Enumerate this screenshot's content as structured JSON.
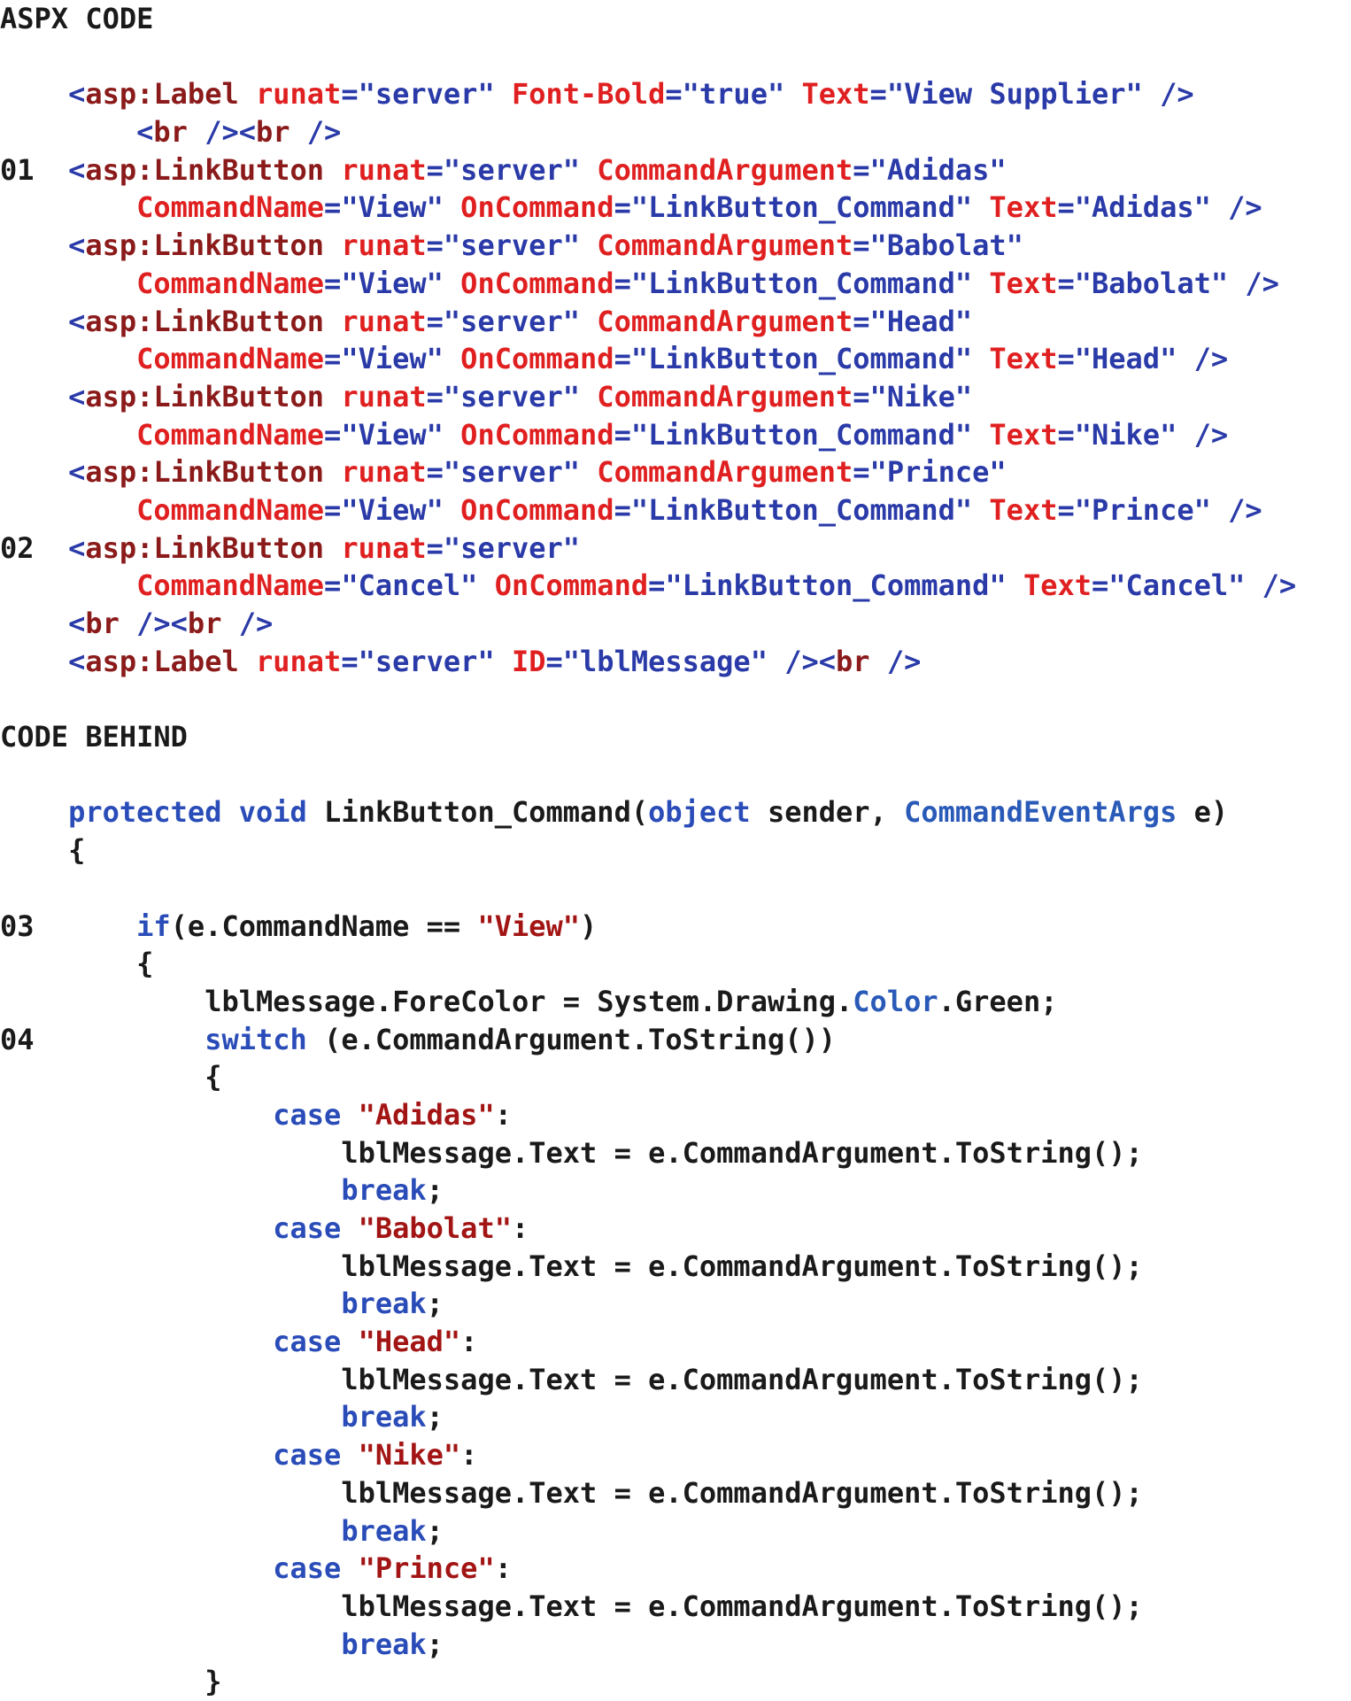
{
  "colors": {
    "default": "#1a1a1a",
    "tag": "#8b1a1a",
    "attribute": "#e02020",
    "attribute_value": "#2a3aa8",
    "delimiter": "#2a3aa8",
    "keyword": "#2a4cb8",
    "type": "#2a5ab8",
    "string": "#a31515"
  },
  "lines": [
    [
      [
        "heading",
        "ASPX CODE"
      ]
    ],
    [],
    [
      [
        "default",
        "    "
      ],
      [
        "delim",
        "<"
      ],
      [
        "tag",
        "asp:Label"
      ],
      [
        "default",
        " "
      ],
      [
        "attr",
        "runat"
      ],
      [
        "delim",
        "="
      ],
      [
        "value",
        "\"server\""
      ],
      [
        "default",
        " "
      ],
      [
        "attr",
        "Font-Bold"
      ],
      [
        "delim",
        "="
      ],
      [
        "value",
        "\"true\""
      ],
      [
        "default",
        " "
      ],
      [
        "attr",
        "Text"
      ],
      [
        "delim",
        "="
      ],
      [
        "value",
        "\"View Supplier\""
      ],
      [
        "default",
        " "
      ],
      [
        "delim",
        "/>"
      ]
    ],
    [
      [
        "default",
        "        "
      ],
      [
        "delim",
        "<"
      ],
      [
        "tag",
        "br"
      ],
      [
        "default",
        " "
      ],
      [
        "delim",
        "/><"
      ],
      [
        "tag",
        "br"
      ],
      [
        "default",
        " "
      ],
      [
        "delim",
        "/>"
      ]
    ],
    [
      [
        "linenum",
        "01"
      ],
      [
        "default",
        "  "
      ],
      [
        "delim",
        "<"
      ],
      [
        "tag",
        "asp:LinkButton"
      ],
      [
        "default",
        " "
      ],
      [
        "attr",
        "runat"
      ],
      [
        "delim",
        "="
      ],
      [
        "value",
        "\"server\""
      ],
      [
        "default",
        " "
      ],
      [
        "attr",
        "CommandArgument"
      ],
      [
        "delim",
        "="
      ],
      [
        "value",
        "\"Adidas\""
      ]
    ],
    [
      [
        "default",
        "        "
      ],
      [
        "attr",
        "CommandName"
      ],
      [
        "delim",
        "="
      ],
      [
        "value",
        "\"View\""
      ],
      [
        "default",
        " "
      ],
      [
        "attr",
        "OnCommand"
      ],
      [
        "delim",
        "="
      ],
      [
        "value",
        "\"LinkButton_Command\""
      ],
      [
        "default",
        " "
      ],
      [
        "attr",
        "Text"
      ],
      [
        "delim",
        "="
      ],
      [
        "value",
        "\"Adidas\""
      ],
      [
        "default",
        " "
      ],
      [
        "delim",
        "/>"
      ]
    ],
    [
      [
        "default",
        "    "
      ],
      [
        "delim",
        "<"
      ],
      [
        "tag",
        "asp:LinkButton"
      ],
      [
        "default",
        " "
      ],
      [
        "attr",
        "runat"
      ],
      [
        "delim",
        "="
      ],
      [
        "value",
        "\"server\""
      ],
      [
        "default",
        " "
      ],
      [
        "attr",
        "CommandArgument"
      ],
      [
        "delim",
        "="
      ],
      [
        "value",
        "\"Babolat\""
      ]
    ],
    [
      [
        "default",
        "        "
      ],
      [
        "attr",
        "CommandName"
      ],
      [
        "delim",
        "="
      ],
      [
        "value",
        "\"View\""
      ],
      [
        "default",
        " "
      ],
      [
        "attr",
        "OnCommand"
      ],
      [
        "delim",
        "="
      ],
      [
        "value",
        "\"LinkButton_Command\""
      ],
      [
        "default",
        " "
      ],
      [
        "attr",
        "Text"
      ],
      [
        "delim",
        "="
      ],
      [
        "value",
        "\"Babolat\""
      ],
      [
        "default",
        " "
      ],
      [
        "delim",
        "/>"
      ]
    ],
    [
      [
        "default",
        "    "
      ],
      [
        "delim",
        "<"
      ],
      [
        "tag",
        "asp:LinkButton"
      ],
      [
        "default",
        " "
      ],
      [
        "attr",
        "runat"
      ],
      [
        "delim",
        "="
      ],
      [
        "value",
        "\"server\""
      ],
      [
        "default",
        " "
      ],
      [
        "attr",
        "CommandArgument"
      ],
      [
        "delim",
        "="
      ],
      [
        "value",
        "\"Head\""
      ]
    ],
    [
      [
        "default",
        "        "
      ],
      [
        "attr",
        "CommandName"
      ],
      [
        "delim",
        "="
      ],
      [
        "value",
        "\"View\""
      ],
      [
        "default",
        " "
      ],
      [
        "attr",
        "OnCommand"
      ],
      [
        "delim",
        "="
      ],
      [
        "value",
        "\"LinkButton_Command\""
      ],
      [
        "default",
        " "
      ],
      [
        "attr",
        "Text"
      ],
      [
        "delim",
        "="
      ],
      [
        "value",
        "\"Head\""
      ],
      [
        "default",
        " "
      ],
      [
        "delim",
        "/>"
      ]
    ],
    [
      [
        "default",
        "    "
      ],
      [
        "delim",
        "<"
      ],
      [
        "tag",
        "asp:LinkButton"
      ],
      [
        "default",
        " "
      ],
      [
        "attr",
        "runat"
      ],
      [
        "delim",
        "="
      ],
      [
        "value",
        "\"server\""
      ],
      [
        "default",
        " "
      ],
      [
        "attr",
        "CommandArgument"
      ],
      [
        "delim",
        "="
      ],
      [
        "value",
        "\"Nike\""
      ]
    ],
    [
      [
        "default",
        "        "
      ],
      [
        "attr",
        "CommandName"
      ],
      [
        "delim",
        "="
      ],
      [
        "value",
        "\"View\""
      ],
      [
        "default",
        " "
      ],
      [
        "attr",
        "OnCommand"
      ],
      [
        "delim",
        "="
      ],
      [
        "value",
        "\"LinkButton_Command\""
      ],
      [
        "default",
        " "
      ],
      [
        "attr",
        "Text"
      ],
      [
        "delim",
        "="
      ],
      [
        "value",
        "\"Nike\""
      ],
      [
        "default",
        " "
      ],
      [
        "delim",
        "/>"
      ]
    ],
    [
      [
        "default",
        "    "
      ],
      [
        "delim",
        "<"
      ],
      [
        "tag",
        "asp:LinkButton"
      ],
      [
        "default",
        " "
      ],
      [
        "attr",
        "runat"
      ],
      [
        "delim",
        "="
      ],
      [
        "value",
        "\"server\""
      ],
      [
        "default",
        " "
      ],
      [
        "attr",
        "CommandArgument"
      ],
      [
        "delim",
        "="
      ],
      [
        "value",
        "\"Prince\""
      ]
    ],
    [
      [
        "default",
        "        "
      ],
      [
        "attr",
        "CommandName"
      ],
      [
        "delim",
        "="
      ],
      [
        "value",
        "\"View\""
      ],
      [
        "default",
        " "
      ],
      [
        "attr",
        "OnCommand"
      ],
      [
        "delim",
        "="
      ],
      [
        "value",
        "\"LinkButton_Command\""
      ],
      [
        "default",
        " "
      ],
      [
        "attr",
        "Text"
      ],
      [
        "delim",
        "="
      ],
      [
        "value",
        "\"Prince\""
      ],
      [
        "default",
        " "
      ],
      [
        "delim",
        "/>"
      ]
    ],
    [
      [
        "linenum",
        "02"
      ],
      [
        "default",
        "  "
      ],
      [
        "delim",
        "<"
      ],
      [
        "tag",
        "asp:LinkButton"
      ],
      [
        "default",
        " "
      ],
      [
        "attr",
        "runat"
      ],
      [
        "delim",
        "="
      ],
      [
        "value",
        "\"server\""
      ]
    ],
    [
      [
        "default",
        "        "
      ],
      [
        "attr",
        "CommandName"
      ],
      [
        "delim",
        "="
      ],
      [
        "value",
        "\"Cancel\""
      ],
      [
        "default",
        " "
      ],
      [
        "attr",
        "OnCommand"
      ],
      [
        "delim",
        "="
      ],
      [
        "value",
        "\"LinkButton_Command\""
      ],
      [
        "default",
        " "
      ],
      [
        "attr",
        "Text"
      ],
      [
        "delim",
        "="
      ],
      [
        "value",
        "\"Cancel\""
      ],
      [
        "default",
        " "
      ],
      [
        "delim",
        "/>"
      ]
    ],
    [
      [
        "default",
        "    "
      ],
      [
        "delim",
        "<"
      ],
      [
        "tag",
        "br"
      ],
      [
        "default",
        " "
      ],
      [
        "delim",
        "/><"
      ],
      [
        "tag",
        "br"
      ],
      [
        "default",
        " "
      ],
      [
        "delim",
        "/>"
      ]
    ],
    [
      [
        "default",
        "    "
      ],
      [
        "delim",
        "<"
      ],
      [
        "tag",
        "asp:Label"
      ],
      [
        "default",
        " "
      ],
      [
        "attr",
        "runat"
      ],
      [
        "delim",
        "="
      ],
      [
        "value",
        "\"server\""
      ],
      [
        "default",
        " "
      ],
      [
        "attr",
        "ID"
      ],
      [
        "delim",
        "="
      ],
      [
        "value",
        "\"lblMessage\""
      ],
      [
        "default",
        " "
      ],
      [
        "delim",
        "/><"
      ],
      [
        "tag",
        "br"
      ],
      [
        "default",
        " "
      ],
      [
        "delim",
        "/>"
      ]
    ],
    [],
    [
      [
        "heading",
        "CODE BEHIND"
      ]
    ],
    [],
    [
      [
        "default",
        "    "
      ],
      [
        "keyword",
        "protected"
      ],
      [
        "default",
        " "
      ],
      [
        "keyword",
        "void"
      ],
      [
        "default",
        " LinkButton_Command("
      ],
      [
        "keyword",
        "object"
      ],
      [
        "default",
        " sender, "
      ],
      [
        "type",
        "CommandEventArgs"
      ],
      [
        "default",
        " e)"
      ]
    ],
    [
      [
        "default",
        "    {"
      ]
    ],
    [],
    [
      [
        "linenum",
        "03"
      ],
      [
        "default",
        "      "
      ],
      [
        "keyword",
        "if"
      ],
      [
        "default",
        "(e.CommandName == "
      ],
      [
        "string",
        "\"View\""
      ],
      [
        "default",
        ")"
      ]
    ],
    [
      [
        "default",
        "        {"
      ]
    ],
    [
      [
        "default",
        "            lblMessage.ForeColor = System.Drawing."
      ],
      [
        "type",
        "Color"
      ],
      [
        "default",
        ".Green;"
      ]
    ],
    [
      [
        "linenum",
        "04"
      ],
      [
        "default",
        "          "
      ],
      [
        "keyword",
        "switch"
      ],
      [
        "default",
        " (e.CommandArgument.ToString())"
      ]
    ],
    [
      [
        "default",
        "            {"
      ]
    ],
    [
      [
        "default",
        "                "
      ],
      [
        "keyword",
        "case"
      ],
      [
        "default",
        " "
      ],
      [
        "string",
        "\"Adidas\""
      ],
      [
        "default",
        ":"
      ]
    ],
    [
      [
        "default",
        "                    lblMessage.Text = e.CommandArgument.ToString();"
      ]
    ],
    [
      [
        "default",
        "                    "
      ],
      [
        "keyword",
        "break"
      ],
      [
        "default",
        ";"
      ]
    ],
    [
      [
        "default",
        "                "
      ],
      [
        "keyword",
        "case"
      ],
      [
        "default",
        " "
      ],
      [
        "string",
        "\"Babolat\""
      ],
      [
        "default",
        ":"
      ]
    ],
    [
      [
        "default",
        "                    lblMessage.Text = e.CommandArgument.ToString();"
      ]
    ],
    [
      [
        "default",
        "                    "
      ],
      [
        "keyword",
        "break"
      ],
      [
        "default",
        ";"
      ]
    ],
    [
      [
        "default",
        "                "
      ],
      [
        "keyword",
        "case"
      ],
      [
        "default",
        " "
      ],
      [
        "string",
        "\"Head\""
      ],
      [
        "default",
        ":"
      ]
    ],
    [
      [
        "default",
        "                    lblMessage.Text = e.CommandArgument.ToString();"
      ]
    ],
    [
      [
        "default",
        "                    "
      ],
      [
        "keyword",
        "break"
      ],
      [
        "default",
        ";"
      ]
    ],
    [
      [
        "default",
        "                "
      ],
      [
        "keyword",
        "case"
      ],
      [
        "default",
        " "
      ],
      [
        "string",
        "\"Nike\""
      ],
      [
        "default",
        ":"
      ]
    ],
    [
      [
        "default",
        "                    lblMessage.Text = e.CommandArgument.ToString();"
      ]
    ],
    [
      [
        "default",
        "                    "
      ],
      [
        "keyword",
        "break"
      ],
      [
        "default",
        ";"
      ]
    ],
    [
      [
        "default",
        "                "
      ],
      [
        "keyword",
        "case"
      ],
      [
        "default",
        " "
      ],
      [
        "string",
        "\"Prince\""
      ],
      [
        "default",
        ":"
      ]
    ],
    [
      [
        "default",
        "                    lblMessage.Text = e.CommandArgument.ToString();"
      ]
    ],
    [
      [
        "default",
        "                    "
      ],
      [
        "keyword",
        "break"
      ],
      [
        "default",
        ";"
      ]
    ],
    [
      [
        "default",
        "            }"
      ]
    ]
  ]
}
